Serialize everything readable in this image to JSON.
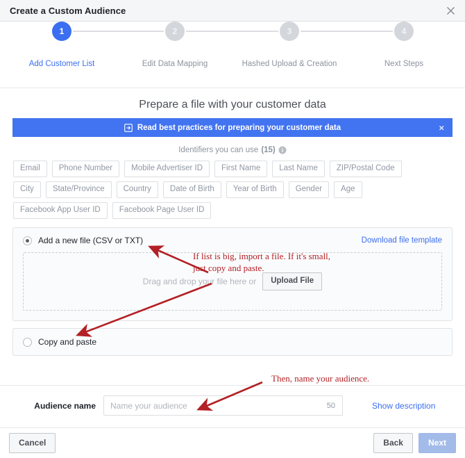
{
  "window": {
    "title": "Create a Custom Audience",
    "close_icon": "close-icon"
  },
  "stepper": {
    "steps": [
      {
        "number": "1",
        "label": "Add Customer List",
        "state": "active"
      },
      {
        "number": "2",
        "label": "Edit Data Mapping",
        "state": "inactive"
      },
      {
        "number": "3",
        "label": "Hashed Upload & Creation",
        "state": "inactive"
      },
      {
        "number": "4",
        "label": "Next Steps",
        "state": "inactive"
      }
    ],
    "active_color": "#3b6ef0",
    "inactive_color": "#d3d6db"
  },
  "main": {
    "section_title": "Prepare a file with your customer data",
    "banner": {
      "icon": "external-link-icon",
      "text": "Read best practices for preparing your customer data",
      "close": "×",
      "background": "#4273f0"
    },
    "identifiers": {
      "heading": "Identifiers you can use",
      "count": "(15)",
      "info_icon": "info-icon",
      "rows": [
        [
          "Email",
          "Phone Number",
          "Mobile Advertiser ID",
          "First Name",
          "Last Name",
          "ZIP/Postal Code"
        ],
        [
          "City",
          "State/Province",
          "Country",
          "Date of Birth",
          "Year of Birth",
          "Gender",
          "Age"
        ],
        [
          "Facebook App User ID",
          "Facebook Page User ID"
        ]
      ]
    },
    "upload_panel": {
      "radio_label": "Add a new file (CSV or TXT)",
      "radio_checked": true,
      "download_link": "Download file template",
      "dropzone_text": "Drag and drop your file here or",
      "upload_button": "Upload File"
    },
    "paste_panel": {
      "radio_label": "Copy and paste",
      "radio_checked": false
    },
    "audience_name": {
      "label": "Audience name",
      "placeholder": "Name your audience",
      "value": "",
      "counter": "50",
      "show_description": "Show description"
    }
  },
  "footer": {
    "cancel": "Cancel",
    "back": "Back",
    "next": "Next"
  },
  "annotations": [
    {
      "id": "anno-import",
      "text": "If list is big, import a file. If it's small,\njust copy and paste."
    },
    {
      "id": "anno-name",
      "text": "Then, name your audience."
    }
  ]
}
